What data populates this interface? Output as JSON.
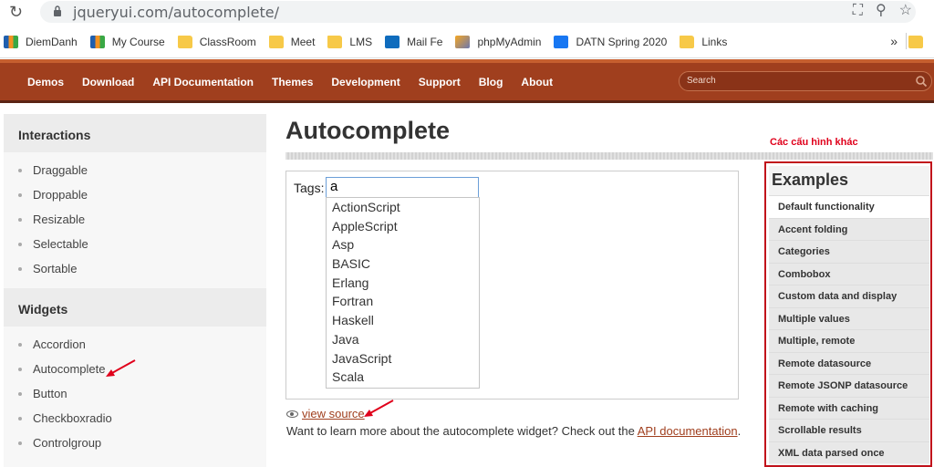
{
  "browser": {
    "url": "jqueryui.com/autocomplete/",
    "bookmarks": [
      {
        "label": "DiemDanh",
        "icon": "fpt-icon"
      },
      {
        "label": "My Course",
        "icon": "fpt-icon"
      },
      {
        "label": "ClassRoom",
        "icon": "folder-icon"
      },
      {
        "label": "Meet",
        "icon": "folder-icon"
      },
      {
        "label": "LMS",
        "icon": "folder-icon"
      },
      {
        "label": "Mail Fe",
        "icon": "outlook-icon"
      },
      {
        "label": "phpMyAdmin",
        "icon": "phpmyadmin-icon"
      },
      {
        "label": "DATN Spring 2020",
        "icon": "facebook-icon"
      },
      {
        "label": "Links",
        "icon": "folder-icon"
      }
    ],
    "more": "»"
  },
  "nav": {
    "links": [
      "Demos",
      "Download",
      "API Documentation",
      "Themes",
      "Development",
      "Support",
      "Blog",
      "About"
    ],
    "search_placeholder": "Search",
    "brand_color": "#a03f1e"
  },
  "sidebar": {
    "interactions_title": "Interactions",
    "interactions": [
      "Draggable",
      "Droppable",
      "Resizable",
      "Selectable",
      "Sortable"
    ],
    "widgets_title": "Widgets",
    "widgets": [
      "Accordion",
      "Autocomplete",
      "Button",
      "Checkboxradio",
      "Controlgroup"
    ]
  },
  "main": {
    "title": "Autocomplete",
    "tags_label": "Tags:",
    "tags_value": "a",
    "suggestions": [
      "ActionScript",
      "AppleScript",
      "Asp",
      "BASIC",
      "Erlang",
      "Fortran",
      "Haskell",
      "Java",
      "JavaScript",
      "Scala"
    ],
    "view_source": "view source",
    "learn_prefix": "Want to learn more about the autocomplete widget? Check out the ",
    "learn_link": "API documentation",
    "learn_suffix": "."
  },
  "annotation": {
    "note": "Các cấu hình khác",
    "color": "#e0001b"
  },
  "examples": {
    "title": "Examples",
    "items": [
      "Default functionality",
      "Accent folding",
      "Categories",
      "Combobox",
      "Custom data and display",
      "Multiple values",
      "Multiple, remote",
      "Remote datasource",
      "Remote JSONP datasource",
      "Remote with caching",
      "Scrollable results",
      "XML data parsed once"
    ]
  }
}
